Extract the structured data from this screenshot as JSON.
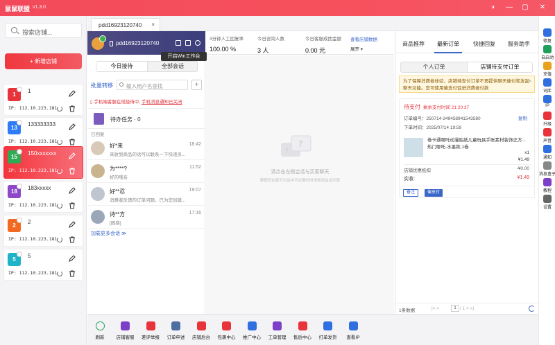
{
  "app": {
    "title": "鼠鼠联盟",
    "version": "v1.3.0"
  },
  "window_controls": {
    "skin": "◑",
    "minimize": "—",
    "maximize": "▢",
    "close": "✕"
  },
  "left": {
    "search_placeholder": "搜索店铺...",
    "add_store_label": "+ 新增店铺",
    "stores": [
      {
        "badge": "1",
        "name": "1",
        "ip": "IP: 112.10.223.181",
        "color": "#e8333b"
      },
      {
        "badge": "13",
        "name": "133333333",
        "ip": "IP: 112.10.223.181",
        "color": "#2f7cf6"
      },
      {
        "badge": "15",
        "name": "150xxxxxxx",
        "ip": "IP: 112.10.223.181",
        "color": "#2faa55"
      },
      {
        "badge": "18",
        "name": "183xxxxx",
        "ip": "IP: 112.10.223.181",
        "color": "#8f47c9"
      },
      {
        "badge": "2",
        "name": "2",
        "ip": "IP: 112.10.223.181",
        "color": "#f26a22"
      },
      {
        "badge": "5",
        "name": "5",
        "ip": "IP: 112.10.223.181",
        "color": "#1fb3c8"
      }
    ]
  },
  "tabs": {
    "active_tab": "pdd16923120740",
    "close": "×",
    "add": "+"
  },
  "conv": {
    "account": "pdd16923120740",
    "tooltip": "开启Win工作台",
    "seg": {
      "today": "今日接待",
      "all": "全部会话"
    },
    "bulk": "批量转移",
    "user_search_placeholder": "输入用户名查找",
    "warn_prefix": "手机端客服在线接待中,",
    "warn_link": "手机消息通知已关闭",
    "pending": "待办任务 · 0",
    "replied_label": "已回复",
    "items": [
      {
        "name": "好*来",
        "preview": "来收到商品的话可以联系一下快递员...",
        "time": "18:42"
      },
      {
        "name": "为****?",
        "preview": "好的哦亲",
        "time": "11:52"
      },
      {
        "name": "好**忍",
        "preview": "消费者反馈的订单问题，已为您创建...",
        "time": "19:07"
      },
      {
        "name": "诗**方",
        "preview": "[困惑]",
        "time": "17:16"
      }
    ],
    "load_more": "加载更多会话 ≫"
  },
  "stats": {
    "items": [
      {
        "label": "3分钟人工回复率",
        "value": "100.00 %"
      },
      {
        "label": "今日咨询人数",
        "value": "3 人"
      },
      {
        "label": "今日客服成团金额",
        "value": "0.00 元"
      }
    ],
    "shop_data_link": "查看店铺数据",
    "expand": "展开 ▾"
  },
  "chat": {
    "hint_main": "请点击左侧会话与买家聊天",
    "hint_sub": "聊聊您在聊天对话中不必要的时候看到会话列表"
  },
  "right": {
    "tabs": [
      "商品推荐",
      "最新订单",
      "快捷回复",
      "服务助手"
    ],
    "seg": {
      "personal": "个人订单",
      "shop": "店铺待支付订单"
    },
    "notice": "为了保障消费者体验，店铺待支付订单不再提供聊天催付和发起聊天功能。您可使用催支付促进消费者付款",
    "order": {
      "status": "待支付",
      "deadline": "剩余支付时间 21:20:37",
      "order_no": "订单编号：250714-349458941543580",
      "copy": "复制",
      "time": "下单时间：2025/07/14 19:59",
      "goods_name": "卷卡通哪吒动漫贴纸儿童玩具手账素材装饰正方... 热门哪吒-水墨款,1卷",
      "qty": "x1",
      "price": "¥1.49",
      "discount_label": "店铺优惠抵扣",
      "discount_value": "-¥0.00",
      "paid_label": "实收:",
      "paid_value": "¥1.49",
      "btn_note": "备注",
      "btn_urge": "催支付"
    },
    "pager": {
      "count": "1条数据",
      "nav": "|<  <  ",
      "page": "1",
      "total": " / 1  >  >|"
    }
  },
  "tools": [
    {
      "label": "修复",
      "color": "#2f6fe0"
    },
    {
      "label": "自启动",
      "color": "#1ea05a"
    },
    {
      "label": "充值",
      "color": "#e8a21c"
    },
    {
      "label": "词库",
      "color": "#2f6fe0"
    },
    {
      "label": "IP",
      "color": "#2f6fe0"
    },
    {
      "label": "升级",
      "color": "#e8333b"
    },
    {
      "label": "声音",
      "color": "#e8333b"
    },
    {
      "label": "通知",
      "color": "#2f6fe0"
    },
    {
      "label": "消息盒子",
      "color": "#888888"
    },
    {
      "label": "教程",
      "color": "#7b3fc8"
    },
    {
      "label": "设置",
      "color": "#666666"
    }
  ],
  "bottom": [
    {
      "label": "刷新",
      "color": "#1ea05a"
    },
    {
      "label": "店铺客服",
      "color": "#7b3fc8"
    },
    {
      "label": "差评举报",
      "color": "#e8333b"
    },
    {
      "label": "订单申述",
      "color": "#4a6fa0"
    },
    {
      "label": "店铺后台",
      "color": "#e8333b"
    },
    {
      "label": "包裹中心",
      "color": "#e8333b"
    },
    {
      "label": "推广中心",
      "color": "#2f6fe0"
    },
    {
      "label": "工单管理",
      "color": "#7b3fc8"
    },
    {
      "label": "售后中心",
      "color": "#e8333b"
    },
    {
      "label": "打单发货",
      "color": "#2f6fe0"
    },
    {
      "label": "查看IP",
      "color": "#2f6fe0"
    }
  ]
}
